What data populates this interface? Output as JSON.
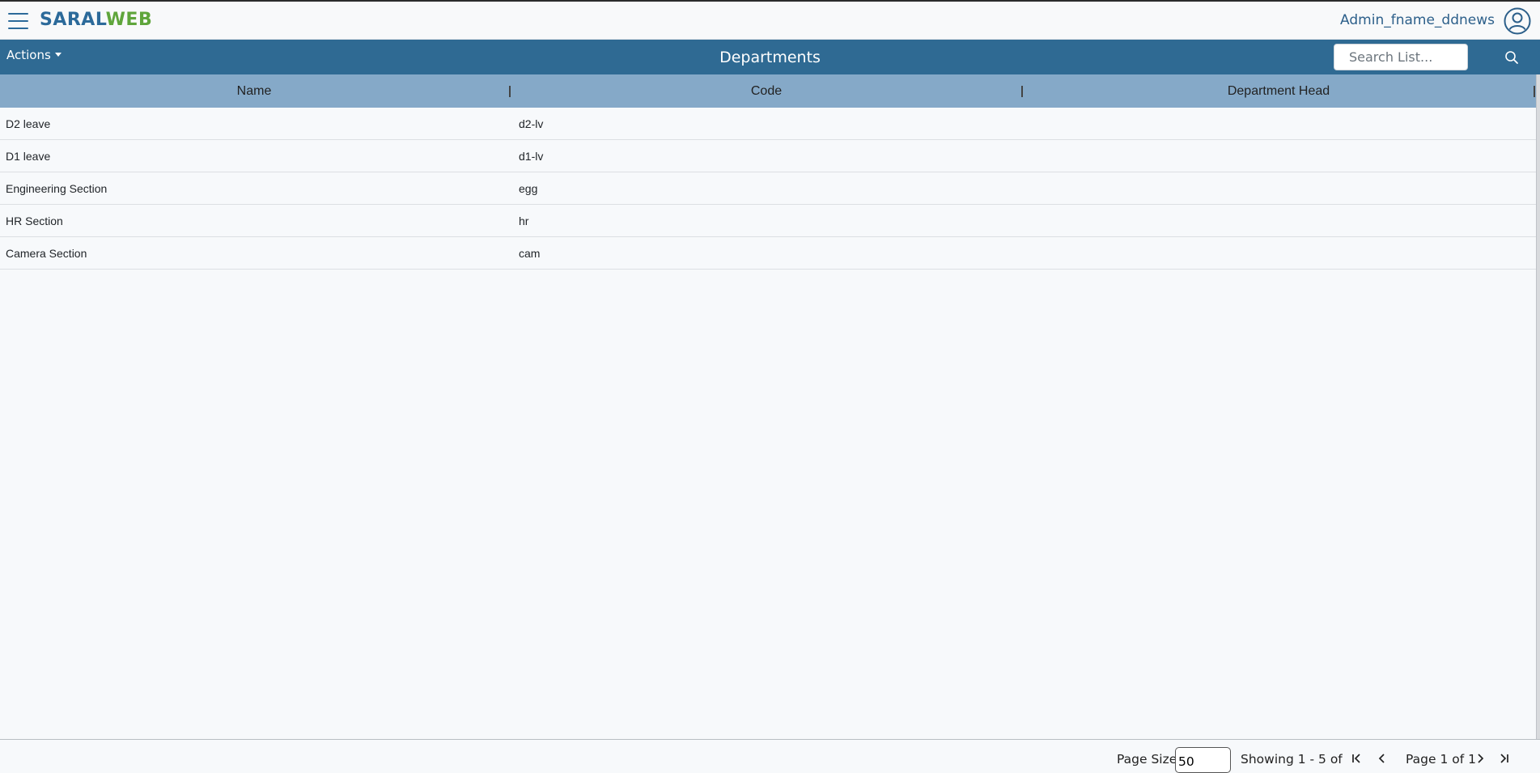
{
  "app": {
    "brand_part1": "SARAL",
    "brand_part2": "WEB",
    "user_name": "Admin_fname_ddnews",
    "brand_color_blue": "#2c6a9a",
    "brand_color_green": "#5fa53b"
  },
  "listbar": {
    "actions_label": "Actions",
    "title": "Departments",
    "search_placeholder": "Search List...",
    "bar_color": "#2f6a93"
  },
  "grid": {
    "columns": [
      "Name",
      "Code",
      "Department Head"
    ],
    "header_color": "#85a9c8",
    "rows": [
      {
        "name": "D2 leave",
        "code": "d2-lv",
        "head": ""
      },
      {
        "name": "D1 leave",
        "code": "d1-lv",
        "head": ""
      },
      {
        "name": "Engineering Section",
        "code": "egg",
        "head": ""
      },
      {
        "name": "HR Section",
        "code": "hr",
        "head": ""
      },
      {
        "name": "Camera Section",
        "code": "cam",
        "head": ""
      }
    ]
  },
  "pager": {
    "page_size_label": "Page Size",
    "page_size_value": "50",
    "showing_text": "Showing 1 - 5 of",
    "page_text": "Page 1 of 1"
  },
  "icons": {
    "menu": "hamburger-menu-icon",
    "user": "user-circle-icon",
    "search": "search-icon",
    "first": "first-page-icon",
    "prev": "previous-page-icon",
    "next": "next-page-icon",
    "last": "last-page-icon"
  }
}
